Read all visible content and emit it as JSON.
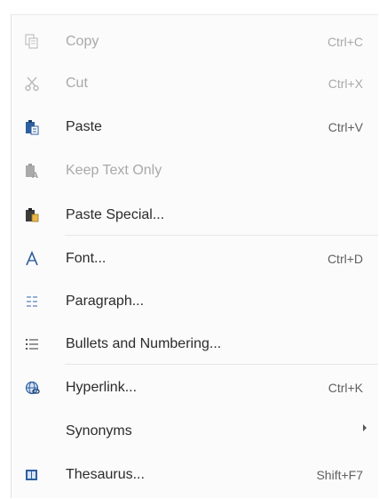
{
  "context_menu": {
    "items": [
      {
        "label": "Copy",
        "shortcut": "Ctrl+C",
        "icon": "copy-icon",
        "enabled": false
      },
      {
        "label": "Cut",
        "shortcut": "Ctrl+X",
        "icon": "scissors-icon",
        "enabled": false
      },
      {
        "label": "Paste",
        "shortcut": "Ctrl+V",
        "icon": "paste-icon",
        "enabled": true
      },
      {
        "label": "Keep Text Only",
        "shortcut": "",
        "icon": "paste-keep-text-icon",
        "enabled": false
      },
      {
        "label": "Paste Special...",
        "shortcut": "",
        "icon": "paste-special-icon",
        "enabled": true
      },
      {
        "label": "Font...",
        "shortcut": "Ctrl+D",
        "icon": "font-icon",
        "enabled": true
      },
      {
        "label": "Paragraph...",
        "shortcut": "",
        "icon": "paragraph-icon",
        "enabled": true
      },
      {
        "label": "Bullets and Numbering...",
        "shortcut": "",
        "icon": "bullets-icon",
        "enabled": true
      },
      {
        "label": "Hyperlink...",
        "shortcut": "Ctrl+K",
        "icon": "hyperlink-icon",
        "enabled": true
      },
      {
        "label": "Synonyms",
        "shortcut": "",
        "icon": "",
        "enabled": true,
        "submenu": true
      },
      {
        "label": "Thesaurus...",
        "shortcut": "Shift+F7",
        "icon": "thesaurus-icon",
        "enabled": true
      }
    ]
  },
  "colors": {
    "accent_blue": "#2f5f9e",
    "disabled_text": "#a9a9a9",
    "menu_background": "#fbfbfb"
  }
}
